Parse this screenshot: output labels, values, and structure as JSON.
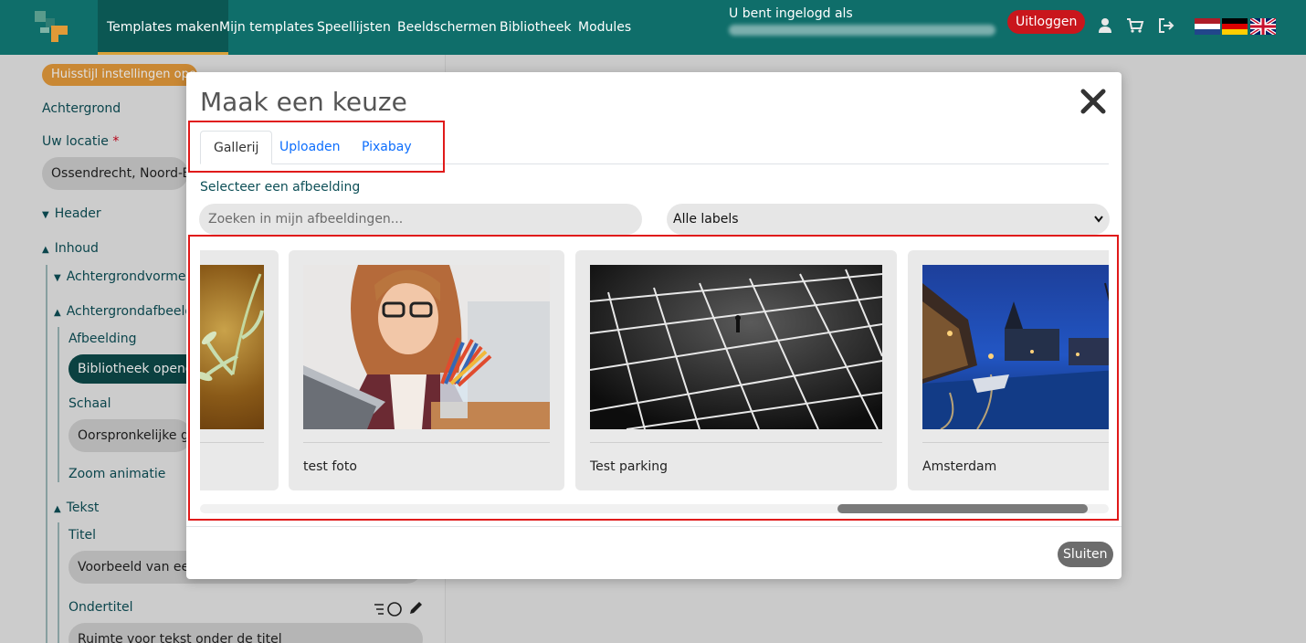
{
  "nav": {
    "items": [
      {
        "label": "Templates maken",
        "active": true
      },
      {
        "label": "Mijn templates"
      },
      {
        "label": "Speellijsten"
      },
      {
        "label": "Beeldschermen"
      },
      {
        "label": "Bibliotheek"
      },
      {
        "label": "Modules"
      }
    ],
    "login_label": "U bent ingelogd als",
    "logout_label": "Uitloggen",
    "icons": [
      "user-icon",
      "cart-icon",
      "signout-icon"
    ],
    "flags": [
      "nl-flag",
      "de-flag",
      "uk-flag"
    ],
    "accent": "#0f6e6a",
    "logout_color": "#c9161c"
  },
  "sidebar": {
    "tag": "Huisstijl instellingen openen",
    "background_label": "Achtergrond",
    "location_label": "Uw locatie",
    "location_value": "Ossendrecht,  Noord-Brabant",
    "header_label": "Header",
    "inhoud_label": "Inhoud",
    "achtergrondvormen_label": "Achtergrondvormen",
    "achtergrondafbeelding_label": "Achtergrondafbeelding",
    "afbeelding_label": "Afbeelding",
    "library_button": "Bibliotheek openen",
    "schaal_label": "Schaal",
    "schaal_value": "Oorspronkelijke grootte",
    "zoom_label": "Zoom animatie",
    "tekst_label": "Tekst",
    "titel_label": "Titel",
    "titel_value": "Voorbeeld van een titel",
    "ondertitel_label": "Ondertitel",
    "ondertitel_value": "Ruimte voor tekst onder de titel"
  },
  "modal": {
    "title": "Maak een keuze",
    "tabs": [
      {
        "label": "Gallerij",
        "active": true
      },
      {
        "label": "Uploaden"
      },
      {
        "label": "Pixabay"
      }
    ],
    "select_label": "Selecteer een afbeelding",
    "search_placeholder": "Zoeken in mijn afbeeldingen...",
    "labels_value": "Alle labels",
    "images": [
      {
        "caption": ""
      },
      {
        "caption": "test foto"
      },
      {
        "caption": "Test parking"
      },
      {
        "caption": "Amsterdam"
      }
    ],
    "close_button": "Sluiten",
    "highlight_color": "#e01a1a"
  }
}
